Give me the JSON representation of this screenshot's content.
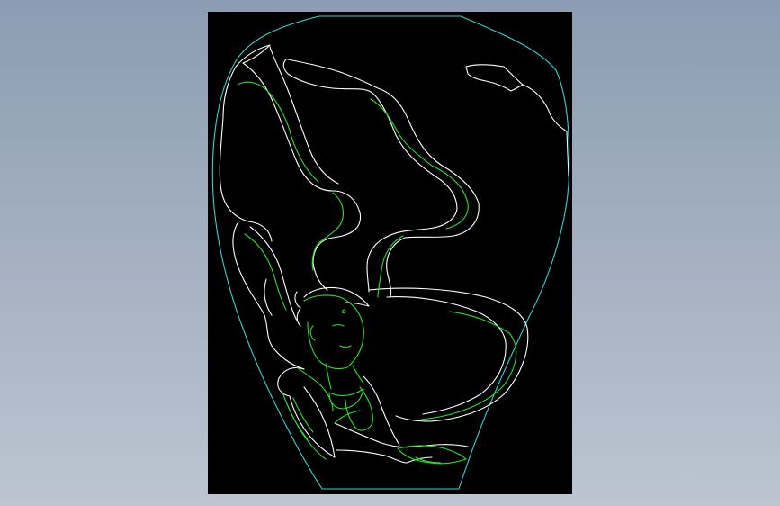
{
  "viewport": {
    "background": "#000000"
  },
  "colors": {
    "vase_outline": "#2fd3d8",
    "line_white": "#ffffff",
    "line_green": "#27e12a",
    "backdrop_top": "#8c9cb2",
    "backdrop_bottom": "#bcc5d1"
  }
}
